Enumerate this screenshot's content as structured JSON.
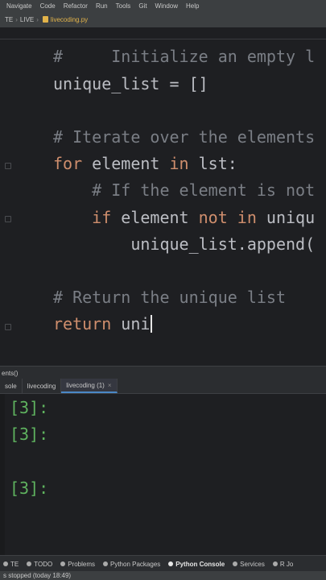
{
  "menubar": {
    "items": [
      "Navigate",
      "Code",
      "Refactor",
      "Run",
      "Tools",
      "Git",
      "Window",
      "Help"
    ]
  },
  "breadcrumb": {
    "left": "TE",
    "middle": "LIVE",
    "file": "livecoding.py"
  },
  "editor": {
    "lines": [
      {
        "parts": [
          {
            "c": "cm",
            "t": "#     Initialize an empty l"
          }
        ]
      },
      {
        "parts": [
          {
            "c": "id",
            "t": "unique_list = []"
          }
        ]
      },
      {
        "parts": [
          {
            "c": "cm",
            "t": "# Iterate over the elements"
          }
        ]
      },
      {
        "parts": [
          {
            "c": "kw",
            "t": "for "
          },
          {
            "c": "id",
            "t": "element "
          },
          {
            "c": "kw",
            "t": "in "
          },
          {
            "c": "id",
            "t": "lst:"
          }
        ]
      },
      {
        "parts": [
          {
            "c": "cm",
            "t": "    # If the element is not"
          }
        ]
      },
      {
        "parts": [
          {
            "c": "kw",
            "t": "    if "
          },
          {
            "c": "id",
            "t": "element "
          },
          {
            "c": "kw",
            "t": "not in "
          },
          {
            "c": "id",
            "t": "uniqu"
          }
        ]
      },
      {
        "parts": [
          {
            "c": "id",
            "t": "        unique_list.append("
          }
        ]
      },
      {
        "parts": [
          {
            "c": "cm",
            "t": "# Return the unique list"
          }
        ]
      },
      {
        "parts": [
          {
            "c": "kw",
            "t": "return "
          },
          {
            "c": "id",
            "t": "uni"
          }
        ]
      }
    ]
  },
  "tool_window": {
    "header": "ents()",
    "tabs": [
      {
        "label": "sole",
        "active": false
      },
      {
        "label": "livecoding",
        "active": false
      },
      {
        "label": "livecoding (1)",
        "active": true
      }
    ]
  },
  "console": {
    "prompts": [
      "[3]:",
      "[3]:",
      "[3]:"
    ]
  },
  "toolstrip": {
    "items": [
      {
        "label": "TE",
        "bold": false
      },
      {
        "label": "TODO",
        "bold": false
      },
      {
        "label": "Problems",
        "bold": false
      },
      {
        "label": "Python Packages",
        "bold": false
      },
      {
        "label": "Python Console",
        "bold": true
      },
      {
        "label": "Services",
        "bold": false
      },
      {
        "label": "R Jo",
        "bold": false
      }
    ]
  },
  "statusbar": {
    "text": "s stopped (today 18:49)"
  }
}
